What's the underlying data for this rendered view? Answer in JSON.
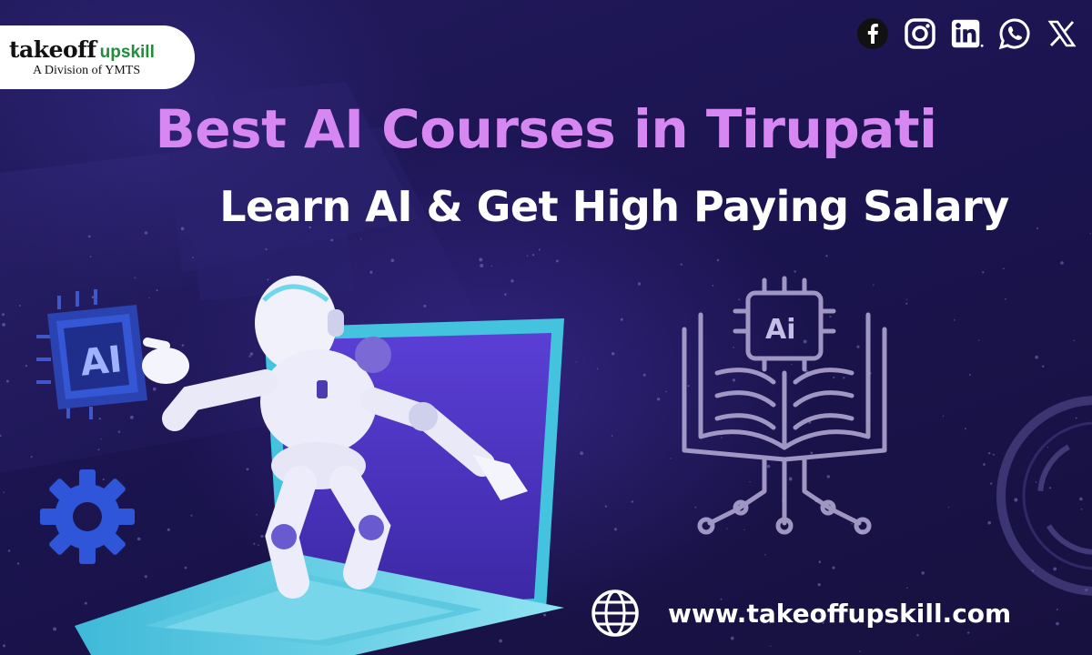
{
  "brand": {
    "name_primary": "takeoff",
    "name_secondary": "upskill",
    "tagline": "A Division of YMTS",
    "accent_color": "#1d8f3a"
  },
  "social": [
    {
      "name": "facebook-icon"
    },
    {
      "name": "instagram-icon"
    },
    {
      "name": "linkedin-icon"
    },
    {
      "name": "whatsapp-icon"
    },
    {
      "name": "x-icon"
    }
  ],
  "headline": {
    "title": "Best AI Courses in Tirupati",
    "subtitle": "Learn AI & Get High Paying Salary",
    "title_color": "#d787f2"
  },
  "illustration": {
    "chip_label": "AI",
    "book_chip_label": "Ai"
  },
  "footer": {
    "website": "www.takeoffupskill.com"
  }
}
